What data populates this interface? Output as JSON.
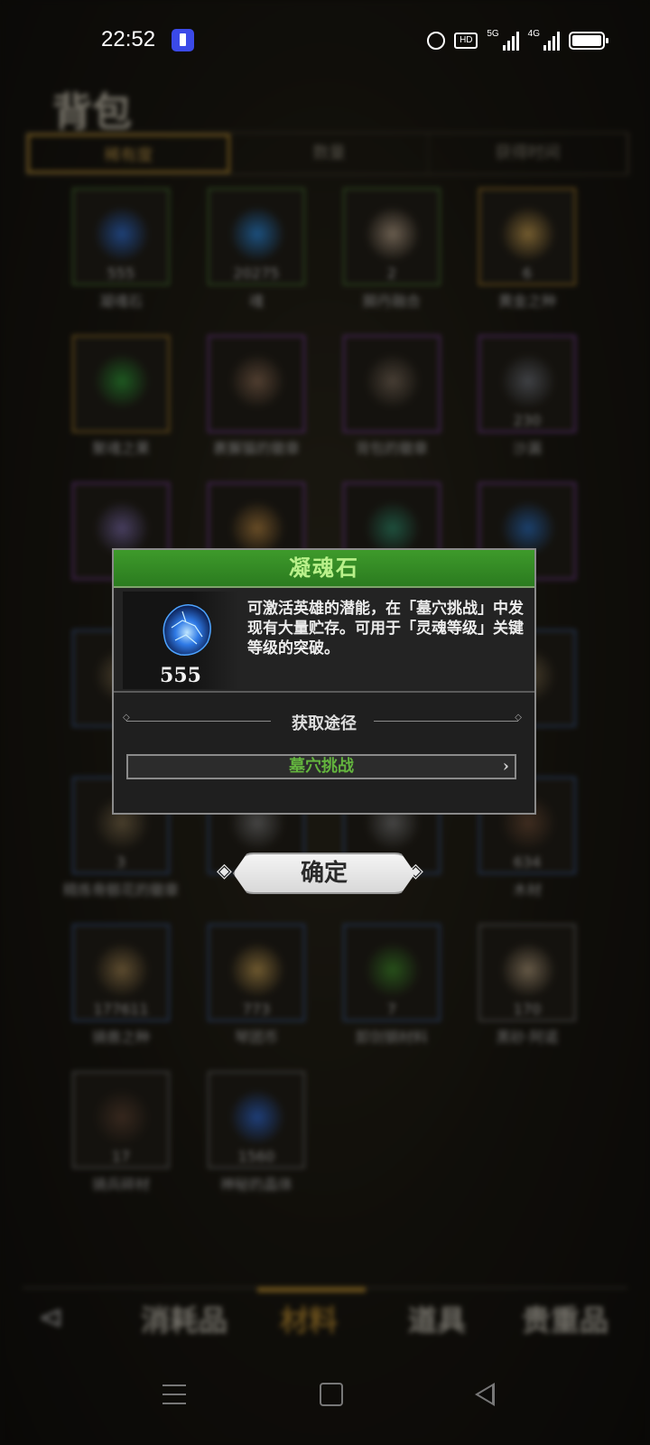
{
  "status_bar": {
    "time": "22:52",
    "hd_label": "HD",
    "net_5g": "5G",
    "net_4g": "4G"
  },
  "bag": {
    "title": "背包",
    "sort_tabs": [
      "稀有度",
      "数量",
      "获得时间"
    ],
    "items": [
      {
        "count": "555",
        "name": "凝魂石",
        "rarity": "green",
        "color": "#2f6fd6"
      },
      {
        "count": "20275",
        "name": "魂",
        "rarity": "green",
        "color": "#2b8ae0"
      },
      {
        "count": "2",
        "name": "脚丹融合",
        "rarity": "green",
        "color": "#b9a38a"
      },
      {
        "count": "6",
        "name": "黄金之种",
        "rarity": "gold",
        "color": "#caa050"
      },
      {
        "count": "",
        "name": "聚魂之果",
        "rarity": "gold",
        "color": "#2e9a36"
      },
      {
        "count": "",
        "name": "裹獬猫的徽章",
        "rarity": "purple",
        "color": "#8a6a52"
      },
      {
        "count": "",
        "name": "背包的徽章",
        "rarity": "purple",
        "color": "#7a6a5a"
      },
      {
        "count": "230",
        "name": "沙漏",
        "rarity": "purple",
        "color": "#6b6f78"
      },
      {
        "count": "",
        "name": "",
        "rarity": "purple",
        "color": "#7a6aa8"
      },
      {
        "count": "",
        "name": "",
        "rarity": "purple",
        "color": "#b58440"
      },
      {
        "count": "",
        "name": "",
        "rarity": "purple",
        "color": "#2f8a6a"
      },
      {
        "count": "",
        "name": "",
        "rarity": "purple",
        "color": "#2a6ec0"
      },
      {
        "count": "",
        "name": "",
        "rarity": "blue",
        "color": "#7c6a4a"
      },
      {
        "count": "",
        "name": "",
        "rarity": "blue",
        "color": "#555"
      },
      {
        "count": "",
        "name": "",
        "rarity": "blue",
        "color": "#555"
      },
      {
        "count": "",
        "name": "",
        "rarity": "blue",
        "color": "#7c6a4a"
      },
      {
        "count": "3",
        "name": "精炼骨骸花的徽章",
        "rarity": "blue",
        "color": "#7c6a4a"
      },
      {
        "count": "",
        "name": "",
        "rarity": "blue",
        "color": "#777"
      },
      {
        "count": "",
        "name": "",
        "rarity": "blue",
        "color": "#777"
      },
      {
        "count": "634",
        "name": "木材",
        "rarity": "blue",
        "color": "#6a4a34"
      },
      {
        "count": "177611",
        "name": "骑兽之种",
        "rarity": "blue",
        "color": "#a08250"
      },
      {
        "count": "773",
        "name": "琴团币",
        "rarity": "blue",
        "color": "#c09a50"
      },
      {
        "count": "7",
        "name": "卸剑钢材料",
        "rarity": "blue",
        "color": "#3f8a2a"
      },
      {
        "count": "170",
        "name": "黑砂·阿诺",
        "rarity": "grey",
        "color": "#b09a7a"
      },
      {
        "count": "17",
        "name": "骑兵碎材",
        "rarity": "grey",
        "color": "#5a4030"
      },
      {
        "count": "1560",
        "name": "神秘的晶体",
        "rarity": "grey",
        "color": "#2f6ad6"
      }
    ],
    "bottom_tabs": [
      "消耗品",
      "材料",
      "道具",
      "贵重品"
    ],
    "active_tab_index": 1
  },
  "dialog": {
    "title": "凝魂石",
    "count": "555",
    "description": "可激活英雄的潜能，在「墓穴挑战」中发现有大量贮存。可用于「灵魂等级」关键等级的突破。",
    "source_heading": "获取途径",
    "source_button": "墓穴挑战",
    "confirm_label": "确定",
    "title_color": "#b9f08a",
    "source_color": "#63b43e"
  }
}
